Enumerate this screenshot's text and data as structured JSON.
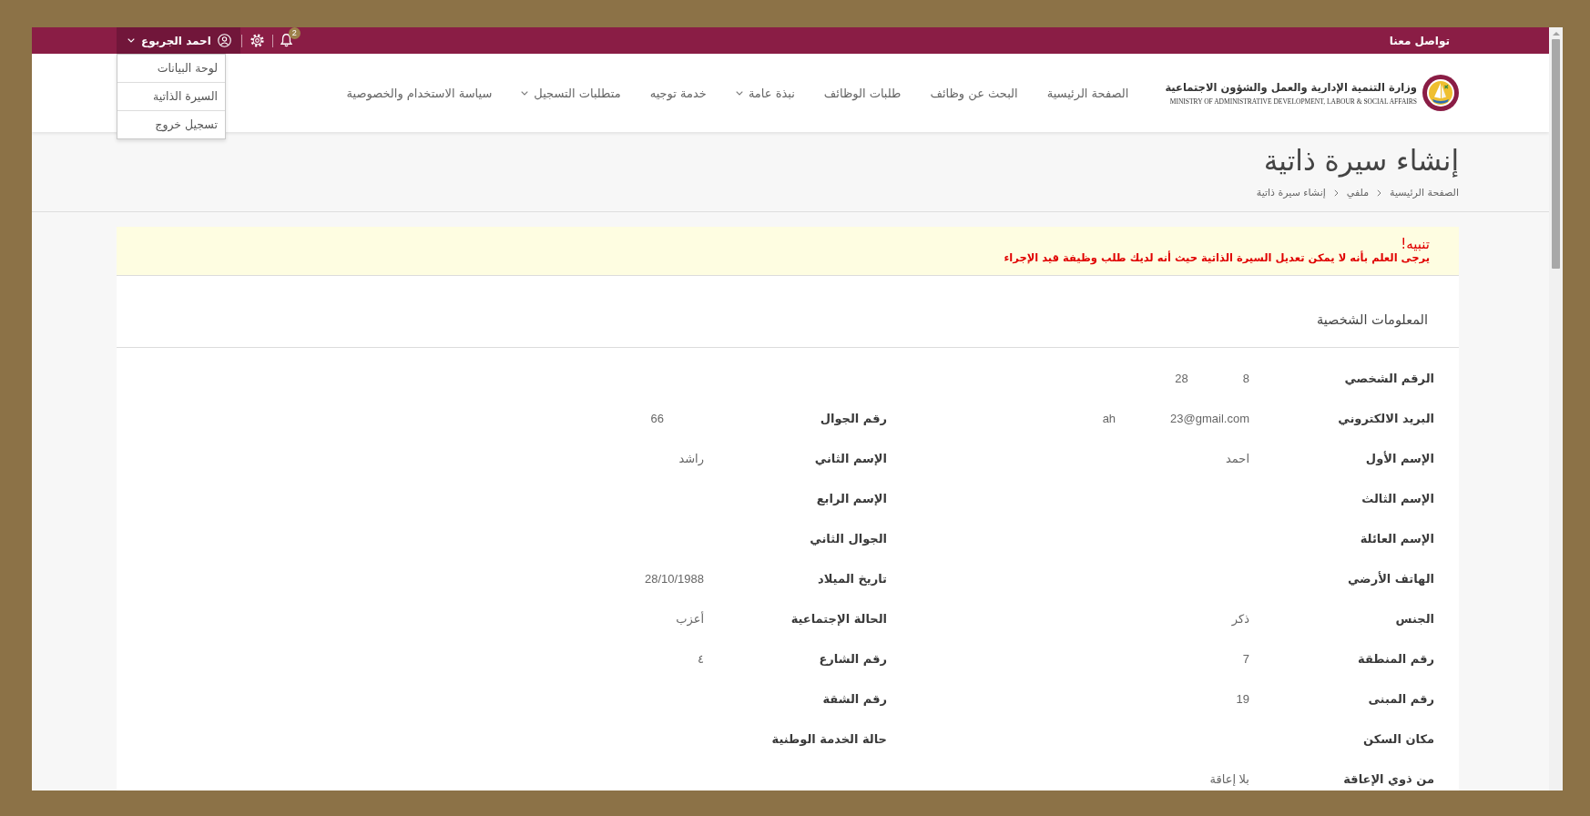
{
  "top_bar": {
    "contact_link": "تواصل معنا",
    "notifications": {
      "count": "2"
    },
    "user_menu": {
      "name": "احمد الجربوع",
      "expanded": true,
      "items": [
        "لوحة البيانات",
        "السيرة الذاتية",
        "تسجيل خروج"
      ]
    }
  },
  "header": {
    "logo": {
      "arabic_name": "وزارة التنمية الإدارية والعمل والشؤون الاجتماعية",
      "english_name": "MINISTRY OF ADMINISTRATIVE DEVELOPMENT, LABOUR & SOCIAL AFFAIRS"
    },
    "nav": [
      {
        "label": "الصفحة الرئيسية",
        "has_menu": false
      },
      {
        "label": "البحث عن وظائف",
        "has_menu": false
      },
      {
        "label": "طلبات الوظائف",
        "has_menu": false
      },
      {
        "label": "نبذة عامة",
        "has_menu": true
      },
      {
        "label": "خدمة توجيه",
        "has_menu": false
      },
      {
        "label": "متطلبات التسجيل",
        "has_menu": true
      },
      {
        "label": "سياسة الاستخدام والخصوصية",
        "has_menu": false
      }
    ]
  },
  "page_title": "إنشاء سيرة ذاتية",
  "breadcrumb": [
    "الصفحة الرئيسية",
    "ملفي",
    "إنشاء سيرة ذاتية"
  ],
  "alert": {
    "title": "تنبيه!",
    "message": "يرجى العلم بأنه لا يمكن تعديل السيرة الذاتية حيث أنه لديك طلب وظيفة قيد الإجراء"
  },
  "section": {
    "title": "المعلومات الشخصية",
    "rows": [
      [
        {
          "label": "الرقم الشخصي",
          "value_parts": [
            "28",
            "8"
          ]
        }
      ],
      [
        {
          "label": "البريد الالكتروني",
          "value_parts": [
            "ah",
            "23@gmail.com"
          ]
        },
        {
          "label": "رقم الجوال",
          "value_parts": [
            "66"
          ],
          "masked_tail": true
        }
      ],
      [
        {
          "label": "الإسم الأول",
          "value": "احمد"
        },
        {
          "label": "الإسم الثاني",
          "value": "راشد"
        }
      ],
      [
        {
          "label": "الإسم الثالث"
        },
        {
          "label": "الإسم الرابع"
        }
      ],
      [
        {
          "label": "الإسم العائلة"
        },
        {
          "label": "الجوال الثاني"
        }
      ],
      [
        {
          "label": "الهاتف الأرضي"
        },
        {
          "label": "تاريخ الميلاد",
          "value": "28/10/1988"
        }
      ],
      [
        {
          "label": "الجنس",
          "value": "ذكر"
        },
        {
          "label": "الحالة الإجتماعية",
          "value": "أعزب"
        }
      ],
      [
        {
          "label": "رقم المنطقة",
          "value": "7"
        },
        {
          "label": "رقم الشارع",
          "value": "٤"
        }
      ],
      [
        {
          "label": "رقم المبنى",
          "value": "19"
        },
        {
          "label": "رقم الشقة"
        }
      ],
      [
        {
          "label": "مكان السكن"
        },
        {
          "label": "حالة الخدمة الوطنية"
        }
      ],
      [
        {
          "label": "من ذوي الإعاقة",
          "value": "بلا إعاقة"
        }
      ]
    ]
  }
}
